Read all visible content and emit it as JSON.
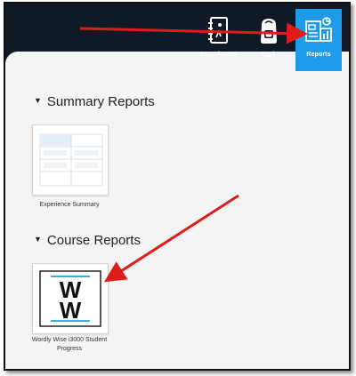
{
  "nav": {
    "items": [
      {
        "label": "Experiences",
        "icon": "journal-icon"
      },
      {
        "label": "Pack",
        "icon": "backpack-icon"
      },
      {
        "label": "Reports",
        "icon": "reports-icon",
        "active": true
      }
    ]
  },
  "sections": [
    {
      "title": "Summary Reports",
      "reports": [
        {
          "caption": "Experience Summary",
          "thumbnail": "table-thumbnail"
        }
      ]
    },
    {
      "title": "Course Reports",
      "reports": [
        {
          "caption": "Wordly Wise i3000 Student Progress",
          "thumbnail": "ww-logo"
        }
      ]
    }
  ],
  "logo": {
    "text": "WW"
  },
  "colors": {
    "topbar": "#0f1a26",
    "active_tab": "#1e9be9",
    "annotation_arrow": "#e01b1b",
    "logo_accent": "#2fb5e6"
  }
}
